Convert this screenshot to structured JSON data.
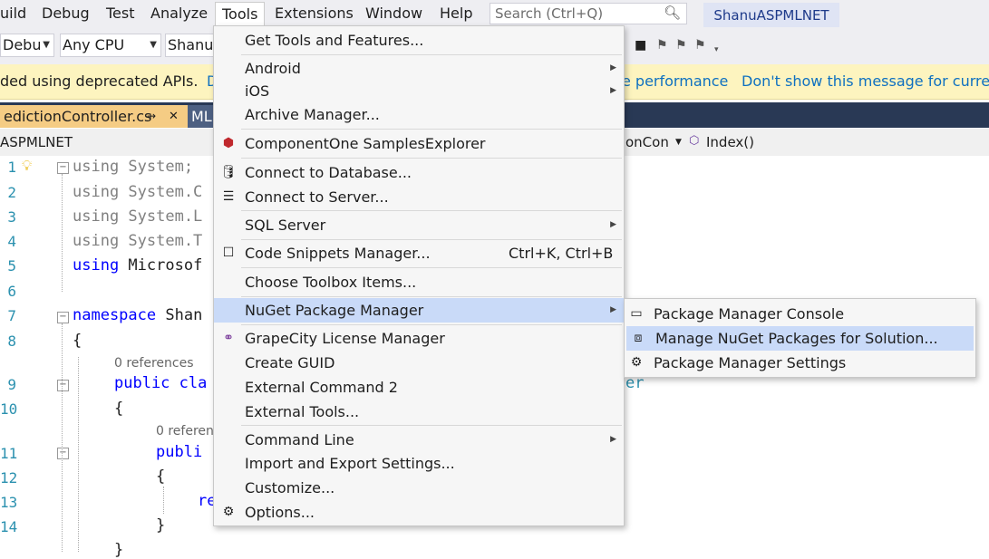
{
  "menubar": {
    "items": [
      "uild",
      "Debug",
      "Test",
      "Analyze",
      "Tools",
      "Extensions",
      "Window",
      "Help"
    ],
    "search_placeholder": "Search (Ctrl+Q)",
    "solution_badge": "ShanuASPMLNET"
  },
  "toolbar": {
    "config": "Debu",
    "platform": "Any CPU",
    "project": "Shanu"
  },
  "infobar": {
    "message": "ded using deprecated APIs.",
    "link_partial": "D",
    "link_perf": "e performance",
    "link_dismiss": "Don't show this message for current"
  },
  "tabs": {
    "active": "edictionController.cs",
    "pin": "⇸",
    "close": "✕",
    "second": "ML"
  },
  "navbar": {
    "project": "ASPMLNET",
    "type_partial": "onCon",
    "member": "Index()"
  },
  "editor": {
    "line_numbers": [
      "1",
      "2",
      "3",
      "4",
      "5",
      "6",
      "7",
      "8",
      "",
      "9",
      "10",
      "",
      "11",
      "12",
      "13",
      "14"
    ],
    "lines": {
      "l1": "using System;",
      "l2": "using System.C",
      "l3": "using System.L",
      "l4": "using System.T",
      "l5_kw": "using",
      "l5_rest": " Microsof",
      "l7_kw": "namespace",
      "l7_rest": " Shan",
      "l8": "{",
      "ref1": "0 references",
      "l9_kw": "public cla",
      "l9_right": "er",
      "l10": "{",
      "ref2": "0 referen",
      "l11_kw": "publi",
      "l12": "{",
      "l13_kw": "re",
      "l14": "}",
      "l15": "}"
    }
  },
  "tools_menu": {
    "items": [
      {
        "label": "Get Tools and Features..."
      },
      {
        "label": "Android",
        "submenu": true
      },
      {
        "label": "iOS",
        "submenu": true
      },
      {
        "label": "Archive Manager..."
      },
      {
        "label": "ComponentOne SamplesExplorer",
        "icon": "componentone-icon"
      },
      {
        "label": "Connect to Database...",
        "icon": "database-connect-icon"
      },
      {
        "label": "Connect to Server...",
        "icon": "server-connect-icon"
      },
      {
        "label": "SQL Server",
        "submenu": true
      },
      {
        "label": "Code Snippets Manager...",
        "shortcut": "Ctrl+K, Ctrl+B",
        "icon": "snippet-icon"
      },
      {
        "label": "Choose Toolbox Items..."
      },
      {
        "label": "NuGet Package Manager",
        "submenu": true,
        "highlighted": true
      },
      {
        "label": "GrapeCity License Manager",
        "icon": "grapecity-icon"
      },
      {
        "label": "Create GUID"
      },
      {
        "label": "External Command 2"
      },
      {
        "label": "External Tools..."
      },
      {
        "label": "Command Line",
        "submenu": true
      },
      {
        "label": "Import and Export Settings..."
      },
      {
        "label": "Customize..."
      },
      {
        "label": "Options...",
        "icon": "gear-icon"
      }
    ]
  },
  "nuget_submenu": {
    "items": [
      {
        "label": "Package Manager Console",
        "icon": "console-icon"
      },
      {
        "label": "Manage NuGet Packages for Solution...",
        "icon": "package-icon",
        "highlighted": true
      },
      {
        "label": "Package Manager Settings",
        "icon": "gear-icon"
      }
    ]
  },
  "colors": {
    "menu_highlight": "#c9daf8",
    "tab_active": "#f5cc84",
    "tabstrip": "#293955",
    "infobar": "#fdf4bf",
    "keyword": "#0000ff"
  }
}
